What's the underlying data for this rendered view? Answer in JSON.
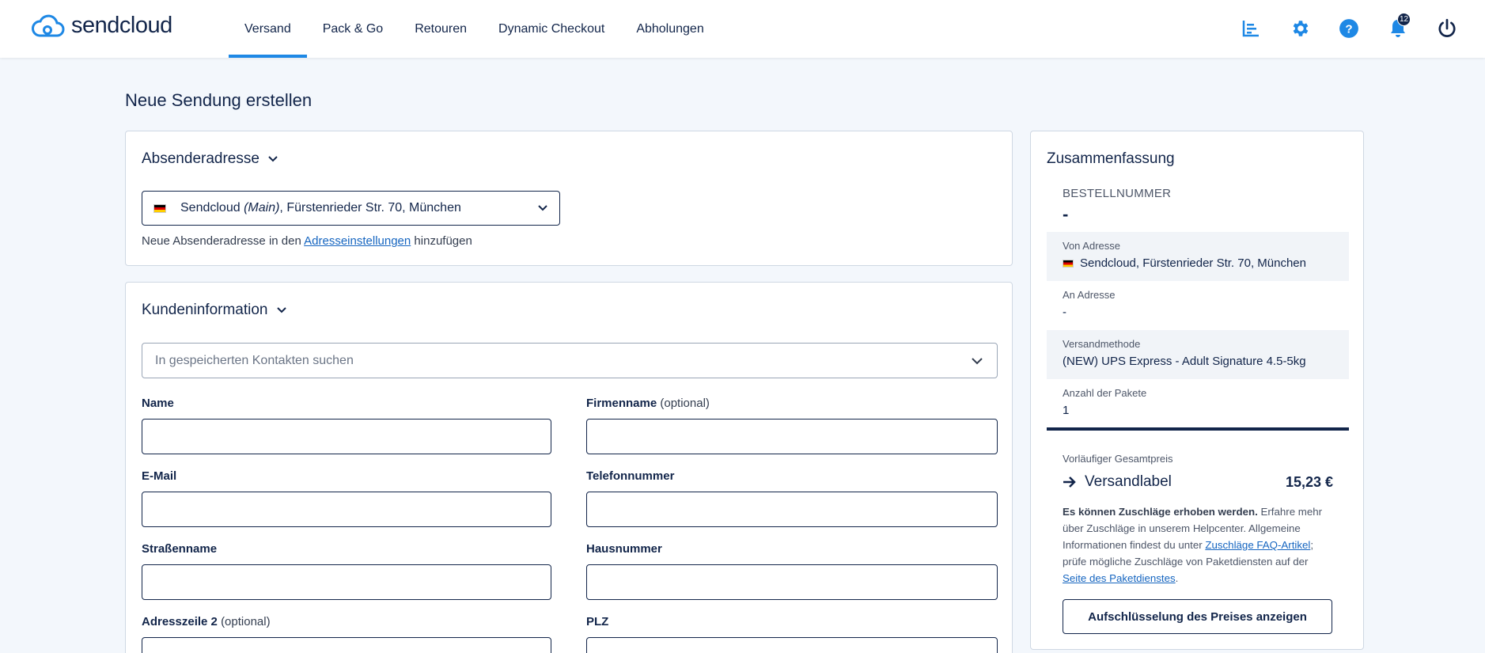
{
  "brand": {
    "name": "sendcloud",
    "accent": "#1e88e5",
    "navy": "#12254a"
  },
  "nav": {
    "items": [
      {
        "label": "Versand",
        "active": true
      },
      {
        "label": "Pack & Go"
      },
      {
        "label": "Retouren"
      },
      {
        "label": "Dynamic Checkout"
      },
      {
        "label": "Abholungen"
      }
    ]
  },
  "top_icons": {
    "analytics": "chart-icon",
    "settings": "gear-icon",
    "help": "help-icon",
    "notifications": "bell-icon",
    "notification_count": "12",
    "logout": "power-icon"
  },
  "page": {
    "title": "Neue Sendung erstellen"
  },
  "sender": {
    "heading": "Absenderadresse",
    "selected_name": "Sendcloud",
    "selected_tag": "(Main)",
    "selected_address": ", Fürstenrieder Str. 70, München",
    "hint_prefix": "Neue Absenderadresse in den",
    "hint_link": "Adresseinstellungen",
    "hint_suffix": "hinzufügen"
  },
  "customer": {
    "heading": "Kundeninformation",
    "search_placeholder": "In gespeicherten Kontakten suchen",
    "fields": {
      "name": "Name",
      "company": "Firmenname",
      "optional": "(optional)",
      "email": "E-Mail",
      "phone": "Telefonnummer",
      "street": "Straßenname",
      "house_number": "Hausnummer",
      "address2": "Adresszeile 2",
      "zip": "PLZ"
    }
  },
  "summary": {
    "heading": "Zusammenfassung",
    "order_label": "BESTELLNUMMER",
    "order_value": "-",
    "from_label": "Von Adresse",
    "from_value": "Sendcloud, Fürstenrieder Str. 70, München",
    "to_label": "An Adresse",
    "to_value": "-",
    "method_label": "Versandmethode",
    "method_value": "(NEW) UPS Express - Adult Signature 4.5-5kg",
    "packages_label": "Anzahl der Pakete",
    "packages_value": "1",
    "prelim_label": "Vorläufiger Gesamtpreis",
    "label_name": "Versandlabel",
    "label_price": "15,23 €",
    "note_bold": "Es können Zuschläge erhoben werden.",
    "note_text1": " Erfahre mehr über Zuschläge in unserem Helpcenter. Allgemeine Informationen findest du unter ",
    "note_link1": "Zuschläge FAQ-Artikel",
    "note_text2": "; prüfe mögliche Zuschläge von Paketdiensten auf der ",
    "note_link2": "Seite des Paketdienstes",
    "note_text3": ".",
    "breakdown_button": "Aufschlüsselung des Preises anzeigen"
  }
}
